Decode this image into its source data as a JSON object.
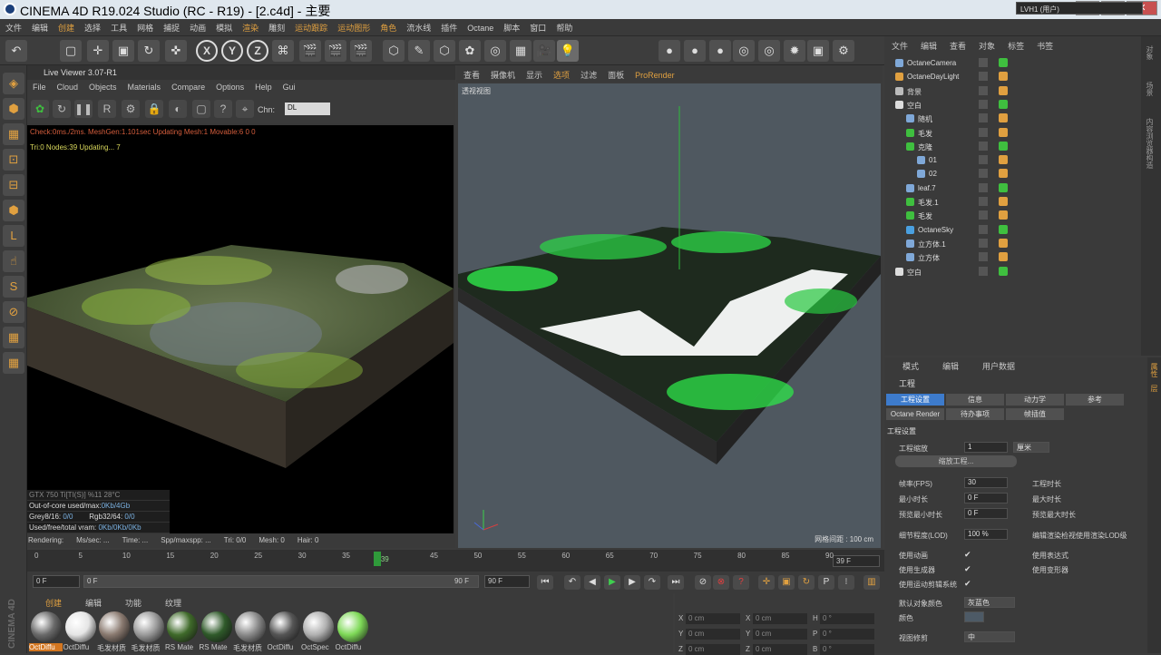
{
  "titlebar": {
    "title": "CINEMA 4D R19.024 Studio (RC - R19) - [2.c4d] - 主要"
  },
  "menubar": {
    "items": [
      "文件",
      "编辑",
      "创建",
      "选择",
      "工具",
      "网格",
      "捕捉",
      "动画",
      "模拟",
      "渲染",
      "雕刻",
      "运动跟踪",
      "运动图形",
      "角色",
      "流水线",
      "插件",
      "Octane",
      "脚本",
      "窗口",
      "帮助"
    ],
    "highlighted": [
      "创建",
      "渲染",
      "运动跟踪",
      "运动图形",
      "角色"
    ],
    "layout_text": "LVH1 (用户)"
  },
  "toolbar": {
    "icons": [
      "undo-icon",
      "select-rect-icon",
      "move-icon",
      "scale-icon",
      "rotate-icon",
      "move-axis-icon",
      "x-lock-icon",
      "y-lock-icon",
      "z-lock-icon",
      "coord-system-icon",
      "render-view-icon",
      "render-picture-icon",
      "render-settings-icon",
      "cube-icon",
      "pen-icon",
      "subdiv-icon",
      "cloner-icon",
      "deformer-icon",
      "floor-icon",
      "camera-icon",
      "light-icon",
      "octane-material-icon",
      "octane-sphere-icon",
      "octane-glossy-icon",
      "octane-env-icon",
      "octane-area-icon",
      "octane-sun-icon",
      "octane-camera-icon",
      "octane-live-icon"
    ],
    "axis_labels": [
      "X",
      "Y",
      "Z"
    ]
  },
  "left_tools": [
    "make-editable-icon",
    "model-mode-icon",
    "texture-mode-icon",
    "point-mode-icon",
    "edge-mode-icon",
    "polygon-mode-icon",
    "enable-axis-icon",
    "tweak-icon",
    "snap-icon",
    "solo-icon",
    "workplane-icon",
    "grid-icon"
  ],
  "brand": "CINEMA 4D",
  "live_viewer": {
    "title": "Live Viewer 3.07-R1",
    "menu": [
      "File",
      "Cloud",
      "Objects",
      "Materials",
      "Compare",
      "Options",
      "Help",
      "Gui"
    ],
    "channel_label": "Chn:",
    "channel_value": "DL",
    "status_line": "Check:0ms./2ms. MeshGen:1.101sec Updating Mesh:1 Movable:6  0 0",
    "nodes_line": "Tri:0 Nodes:39  Updating...     7",
    "gpu": "GTX 750 Ti[TI(S)]        %11     28°C",
    "stats": [
      {
        "label": "Out-of-core used/max:",
        "value": "0Kb/4Gb"
      },
      {
        "label": "Grey8/16: ",
        "value": "0/0",
        "label2": "Rgb32/64: ",
        "value2": "0/0"
      },
      {
        "label": "Used/free/total vram: ",
        "value": "0Kb/0Kb/0Kb"
      }
    ],
    "footer": [
      "Rendering:",
      "Ms/sec: ...",
      "Time: ...",
      "Spp/maxspp: ...",
      "Tri: 0/0",
      "Mesh: 0",
      "Hair: 0"
    ]
  },
  "viewport": {
    "menu": [
      "查看",
      "摄像机",
      "显示",
      "选项",
      "过滤",
      "面板",
      "ProRender"
    ],
    "highlighted": [
      "选项",
      "ProRender"
    ],
    "label": "透视视图",
    "grid_spacing": "网格间距 : 100 cm"
  },
  "timeline": {
    "ticks": [
      "0",
      "5",
      "10",
      "15",
      "20",
      "25",
      "30",
      "35",
      "39",
      "45",
      "50",
      "55",
      "60",
      "65",
      "70",
      "75",
      "80",
      "85",
      "90"
    ],
    "current": "39",
    "frame_field": "39 F",
    "start": "0 F",
    "range_left": "0 F",
    "range_right": "90 F",
    "end": "90 F"
  },
  "materials": {
    "tabs": [
      "创建",
      "编辑",
      "功能",
      "纹理"
    ],
    "items": [
      {
        "label": "OctDiffu",
        "color": "#6a6a6a",
        "selected": true
      },
      {
        "label": "OctDiffu",
        "color": "#e5e5e5",
        "selected": false
      },
      {
        "label": "毛发材质",
        "color": "#8a7a70",
        "selected": false
      },
      {
        "label": "毛发材质",
        "color": "#9a9a9a",
        "selected": false
      },
      {
        "label": "RS Mate",
        "color": "#3f6a2a",
        "selected": false
      },
      {
        "label": "RS Mate",
        "color": "#2f5a2a",
        "selected": false
      },
      {
        "label": "毛发材质",
        "color": "#8a8a8a",
        "selected": false
      },
      {
        "label": "OctDiffu",
        "color": "#555555",
        "selected": false
      },
      {
        "label": "OctSpec",
        "color": "#b0b0b0",
        "selected": false
      },
      {
        "label": "OctDiffu",
        "color": "#7ed957",
        "selected": false
      }
    ]
  },
  "coords": {
    "rows": [
      {
        "a": "X",
        "av": "0 cm",
        "b": "X",
        "bv": "0 cm",
        "c": "H",
        "cv": "0 °"
      },
      {
        "a": "Y",
        "av": "0 cm",
        "b": "Y",
        "bv": "0 cm",
        "c": "P",
        "cv": "0 °"
      },
      {
        "a": "Z",
        "av": "0 cm",
        "b": "Z",
        "bv": "0 cm",
        "c": "B",
        "cv": "0 °"
      }
    ]
  },
  "object_manager": {
    "menu": [
      "文件",
      "编辑",
      "查看",
      "对象",
      "标签",
      "书签"
    ],
    "rows": [
      {
        "name": "OctaneCamera",
        "indent": 0
      },
      {
        "name": "OctaneDayLight",
        "indent": 0
      },
      {
        "name": "背景",
        "indent": 0
      },
      {
        "name": "空白",
        "indent": 0
      },
      {
        "name": "随机",
        "indent": 1
      },
      {
        "name": "毛发",
        "indent": 1
      },
      {
        "name": "克隆",
        "indent": 1
      },
      {
        "name": "01",
        "indent": 2
      },
      {
        "name": "02",
        "indent": 2
      },
      {
        "name": "leaf.7",
        "indent": 1
      },
      {
        "name": "毛发.1",
        "indent": 1
      },
      {
        "name": "毛发",
        "indent": 1
      },
      {
        "name": "OctaneSky",
        "indent": 1
      },
      {
        "name": "立方体.1",
        "indent": 1
      },
      {
        "name": "立方体",
        "indent": 1
      },
      {
        "name": "空白",
        "indent": 0
      }
    ],
    "side_tabs": [
      "对象",
      "场景",
      "内容浏览器",
      "构造"
    ]
  },
  "attributes": {
    "menu": [
      "模式",
      "编辑",
      "用户数据"
    ],
    "title": "工程",
    "tabs_row1": [
      "工程设置",
      "信息",
      "动力学",
      "参考"
    ],
    "tabs_row2": [
      "Octane Render",
      "待办事项",
      "帧插值"
    ],
    "section": "工程设置",
    "scale_label": "工程缩放",
    "scale_value": "1",
    "scale_unit": "厘米",
    "scale_button": "缩放工程...",
    "fps_label": "帧率(FPS)",
    "fps_value": "30",
    "duration_label": "工程时长",
    "min_label": "最小时长",
    "min_value": "0 F",
    "max_label": "最大时长",
    "pmin_label": "预览最小时长",
    "pmin_value": "0 F",
    "pmax_label": "预览最大时长",
    "lod_label": "细节程度(LOD)",
    "lod_value": "100 %",
    "lod_right": "编辑渲染检视使用渲染LOD级",
    "checks": [
      {
        "label": "使用动画",
        "right": "使用表达式"
      },
      {
        "label": "使用生成器",
        "right": "使用变形器"
      },
      {
        "label": "使用运动剪辑系统",
        "right": ""
      }
    ],
    "default_color_label": "默认对象颜色",
    "default_color_value": "灰蓝色",
    "color_label": "颜色",
    "view_clip_label": "视图修剪",
    "view_clip_value": "中",
    "side_tabs": [
      "属性",
      "层"
    ]
  }
}
